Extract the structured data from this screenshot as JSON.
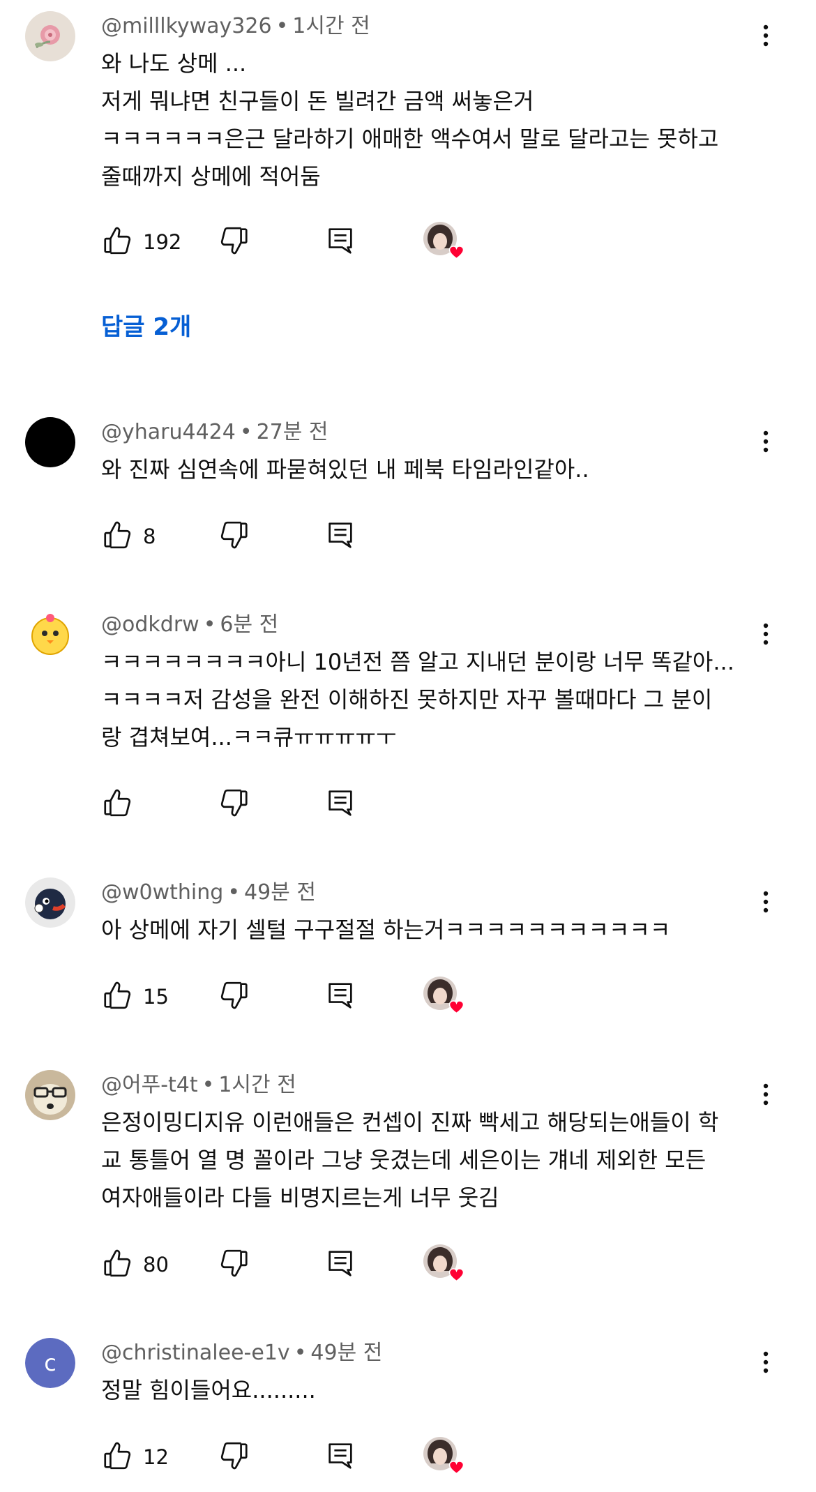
{
  "accent_color": "#065fd4",
  "icons": {
    "like": "thumbs-up-icon",
    "dislike": "thumbs-down-icon",
    "reply": "reply-icon",
    "more": "more-vertical-icon",
    "creator_heart": "creator-heart-icon"
  },
  "comments": [
    {
      "handle": "@milllkyway326",
      "time": "1시간 전",
      "text": "와 나도 상메 ...\n저게 뭐냐면 친구들이 돈 빌려간 금액 써놓은거\nㅋㅋㅋㅋㅋㅋ은근 달라하기 애매한 액수여서 말로 달라고는 못하고\n줄때까지 상메에 적어둠",
      "likes": "192",
      "hearted": true,
      "replies_label": "답글 2개"
    },
    {
      "handle": "@yharu4424",
      "time": "27분 전",
      "text": "와 진짜 심연속에 파묻혀있던 내 페북 타임라인같아..",
      "likes": "8",
      "hearted": false
    },
    {
      "handle": "@odkdrw",
      "time": "6분 전",
      "text": "ㅋㅋㅋㅋㅋㅋㅋㅋ아니 10년전 쯤 알고 지내던 분이랑 너무 똑같아...\nㅋㅋㅋㅋ저 감성을 완전 이해하진 못하지만 자꾸 볼때마다 그 분이\n랑 겹쳐보여...ㅋㅋ큐ㅠㅠㅠㅠㅜ",
      "likes": "",
      "hearted": false
    },
    {
      "handle": "@w0wthing",
      "time": "49분 전",
      "text": "아 상메에 자기 셀털 구구절절 하는거ㅋㅋㅋㅋㅋㅋㅋㅋㅋㅋㅋ",
      "likes": "15",
      "hearted": true
    },
    {
      "handle": "@어푸-t4t",
      "time": "1시간 전",
      "text": "은정이밍디지유 이런애들은 컨셉이 진짜 빡세고 해당되는애들이 학\n교 통틀어 열 명 꼴이라 그냥 웃겼는데 세은이는 걔네 제외한 모든\n여자애들이라 다들 비명지르는게 너무 웃김",
      "likes": "80",
      "hearted": true
    },
    {
      "handle": "@christinalee-e1v",
      "time": "49분 전",
      "text": "정말 힘이들어요.........",
      "likes": "12",
      "hearted": true,
      "avatar_letter": "c"
    }
  ]
}
